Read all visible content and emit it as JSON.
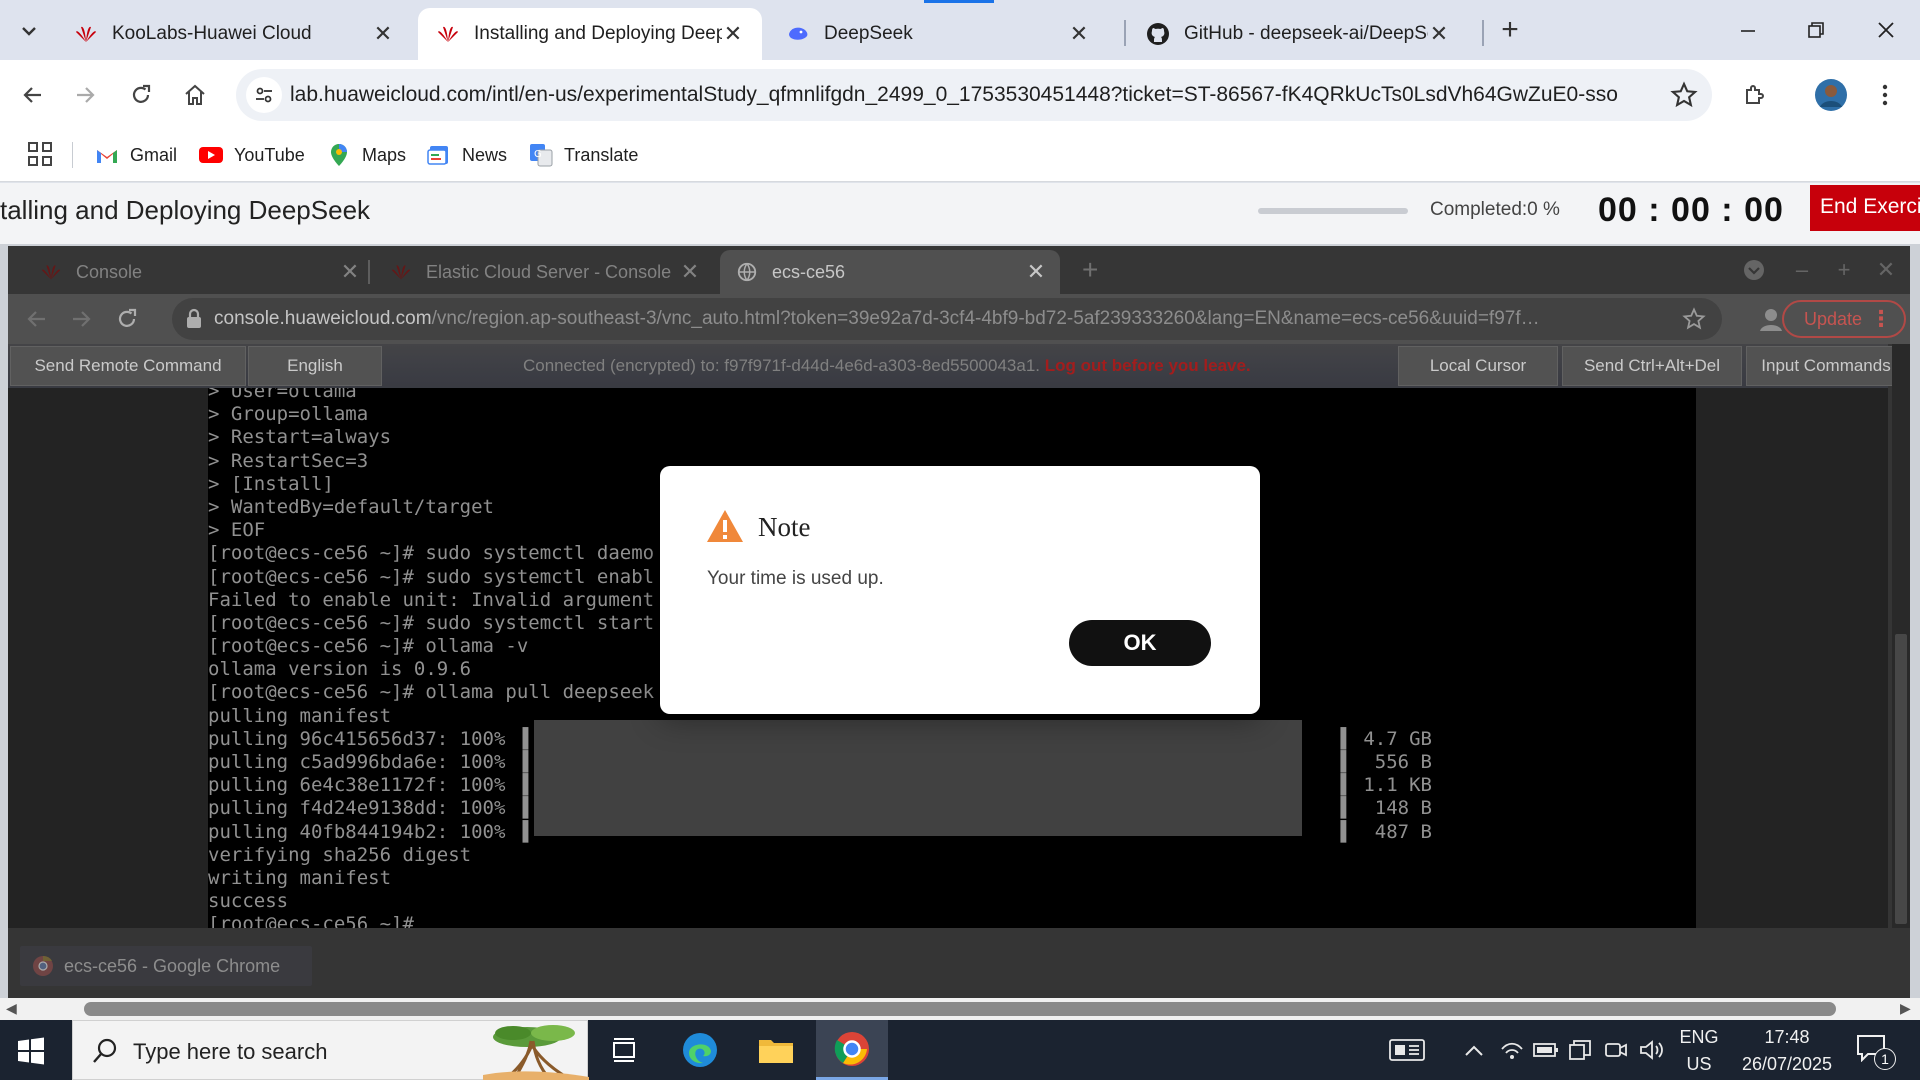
{
  "browser": {
    "tabs": [
      {
        "title": "KooLabs-Huawei Cloud",
        "icon": "huawei-logo"
      },
      {
        "title": "Installing and Deploying DeepS",
        "icon": "huawei-logo",
        "active": true
      },
      {
        "title": "DeepSeek",
        "icon": "deepseek-whale"
      },
      {
        "title": "GitHub - deepseek-ai/DeepSeek",
        "icon": "github-logo"
      }
    ],
    "url": "lab.huaweicloud.com/intl/en-us/experimentalStudy_qfmnlifgdn_2499_0_1753530451448?ticket=ST-86567-fK4QRkUcTs0LsdVh64GwZuE0-sso",
    "bookmarks": [
      "Gmail",
      "YouTube",
      "Maps",
      "News",
      "Translate"
    ]
  },
  "lab": {
    "title": "talling and Deploying DeepSeek",
    "completed": "Completed:0 %",
    "progress": 0,
    "timer": "00 : 00 : 00",
    "end_button": "End Exerci"
  },
  "inner_browser": {
    "tabs": [
      {
        "title": "Console"
      },
      {
        "title": "Elastic Cloud Server - Console"
      },
      {
        "title": "ecs-ce56",
        "active": true
      }
    ],
    "url_host": "console.huaweicloud.com",
    "url_path": "/vnc/region.ap-southeast-3/vnc_auto.html?token=39e92a7d-3cf4-4bf9-bd72-5af239333260&lang=EN&name=ecs-ce56&uuid=f97f…",
    "update_button": "Update"
  },
  "vnc": {
    "send_remote_command": "Send Remote Command",
    "language": "English",
    "status": "Connected (encrypted) to: f97f971f-d44d-4e6d-a303-8ed5500043a1.",
    "status_warning": "Log out before you leave.",
    "local_cursor": "Local Cursor",
    "send_ctrl_alt_del": "Send Ctrl+Alt+Del",
    "input_commands": "Input Commands"
  },
  "terminal": {
    "lines": [
      "> User=ollama",
      "> Group=ollama",
      "> Restart=always",
      "> RestartSec=3",
      "> [Install]",
      "> WantedBy=default/target",
      "> EOF",
      "[root@ecs-ce56 ~]# sudo systemctl daemo",
      "[root@ecs-ce56 ~]# sudo systemctl enabl",
      "Failed to enable unit: Invalid argument",
      "[root@ecs-ce56 ~]# sudo systemctl start",
      "[root@ecs-ce56 ~]# ollama -v",
      "ollama version is 0.9.6",
      "[root@ecs-ce56 ~]# ollama pull deepseek",
      "pulling manifest",
      "pulling 96c415656d37: 100% ▐                                                                       ▌ 4.7 GB",
      "pulling c5ad996bda6e: 100% ▐                                                                       ▌  556 B",
      "pulling 6e4c38e1172f: 100% ▐                                                                       ▌ 1.1 KB",
      "pulling f4d24e9138dd: 100% ▐                                                                       ▌  148 B",
      "pulling 40fb844194b2: 100% ▐                                                                       ▌  487 B",
      "verifying sha256 digest",
      "writing manifest",
      "success",
      "[root@ecs-ce56 ~]#"
    ]
  },
  "status_chip": "ecs-ce56 - Google Chrome",
  "modal": {
    "title": "Note",
    "message": "Your time is used up.",
    "ok": "OK"
  },
  "taskbar": {
    "search_placeholder": "Type here to search",
    "lang_top": "ENG",
    "lang_bottom": "US",
    "time": "17:48",
    "date": "26/07/2025",
    "notifications": "1"
  },
  "colors": {
    "huawei_red": "#c7000b",
    "accent_blue": "#1a73e8",
    "taskbar": "#1b2330"
  }
}
